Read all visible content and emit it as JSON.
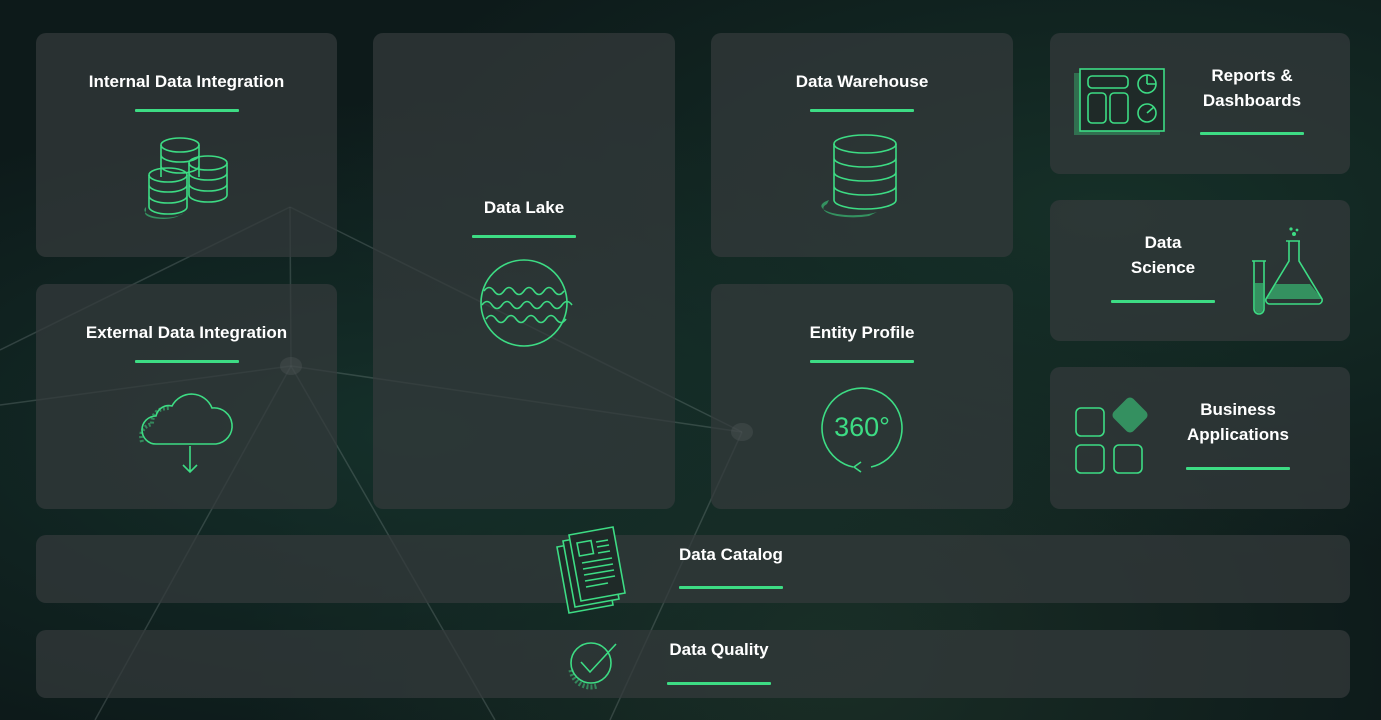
{
  "colors": {
    "accent": "#3ddc84",
    "card": "#343a3c",
    "background": "#0d1a1a"
  },
  "cards": {
    "internal": {
      "title": "Internal Data Integration",
      "icon": "database-stack-icon"
    },
    "lake": {
      "title": "Data Lake",
      "icon": "waves-circle-icon"
    },
    "warehouse": {
      "title": "Data Warehouse",
      "icon": "database-icon"
    },
    "reports": {
      "title_line1": "Reports &",
      "title_line2": "Dashboards",
      "icon": "dashboard-icon"
    },
    "external": {
      "title": "External Data Integration",
      "icon": "cloud-download-icon"
    },
    "entity": {
      "title": "Entity Profile",
      "icon_text": "360°",
      "icon": "rotate-360-icon"
    },
    "science": {
      "title_line1": "Data",
      "title_line2": "Science",
      "icon": "lab-flask-icon"
    },
    "business": {
      "title_line1": "Business",
      "title_line2": "Applications",
      "icon": "apps-grid-icon"
    },
    "catalog": {
      "title": "Data Catalog",
      "icon": "documents-icon"
    },
    "quality": {
      "title": "Data Quality",
      "icon": "check-circle-icon"
    }
  }
}
